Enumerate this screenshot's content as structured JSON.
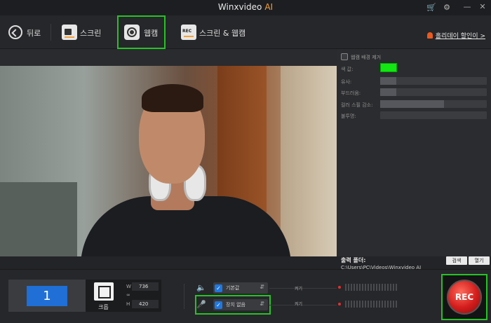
{
  "titlebar": {
    "app_name": "Winxvideo",
    "app_suffix": "AI",
    "icons": [
      "cart-icon",
      "settings-icon",
      "minimize-icon",
      "close-icon"
    ]
  },
  "toolbar": {
    "back_label": "뒤로",
    "modes": [
      {
        "label": "스크린",
        "icon": "camera-icon",
        "selected": false
      },
      {
        "label": "웹캠",
        "icon": "webcam-icon",
        "selected": true
      },
      {
        "label": "스크린 & 웹캠",
        "icon": "rec-icon",
        "selected": false
      }
    ],
    "promo_link": "홀리데이 할인이 >"
  },
  "webcam_settings": {
    "remove_bg_label": "웹캠 배경 제거",
    "remove_bg_checked": false,
    "color_label": "색 값:",
    "color_value": "#14e614",
    "similarity_label": "유사:",
    "similarity_level": 0.15,
    "smoothness_label": "부드러움:",
    "smoothness_level": 0.15,
    "spill_label": "컬러 스필 감소:",
    "spill_level": 0.6,
    "opacity_label": "불투명:",
    "opacity_level": 0.0
  },
  "output": {
    "label": "출력 폴더:",
    "path": "C:\\Users\\PC\\Videos\\Winxvideo AI",
    "browse_label": "검색",
    "open_label": "열기"
  },
  "bottom": {
    "screen_number": "1",
    "crop_label": "크롭",
    "width_key": "W",
    "width_value": "736",
    "height_key": "H",
    "height_value": "420",
    "system_audio": {
      "label": "기본값",
      "checked": true,
      "toggle": "켜기"
    },
    "microphone": {
      "label": "장치 없음",
      "checked": true,
      "toggle": "켜기"
    },
    "rec_label": "REC"
  }
}
